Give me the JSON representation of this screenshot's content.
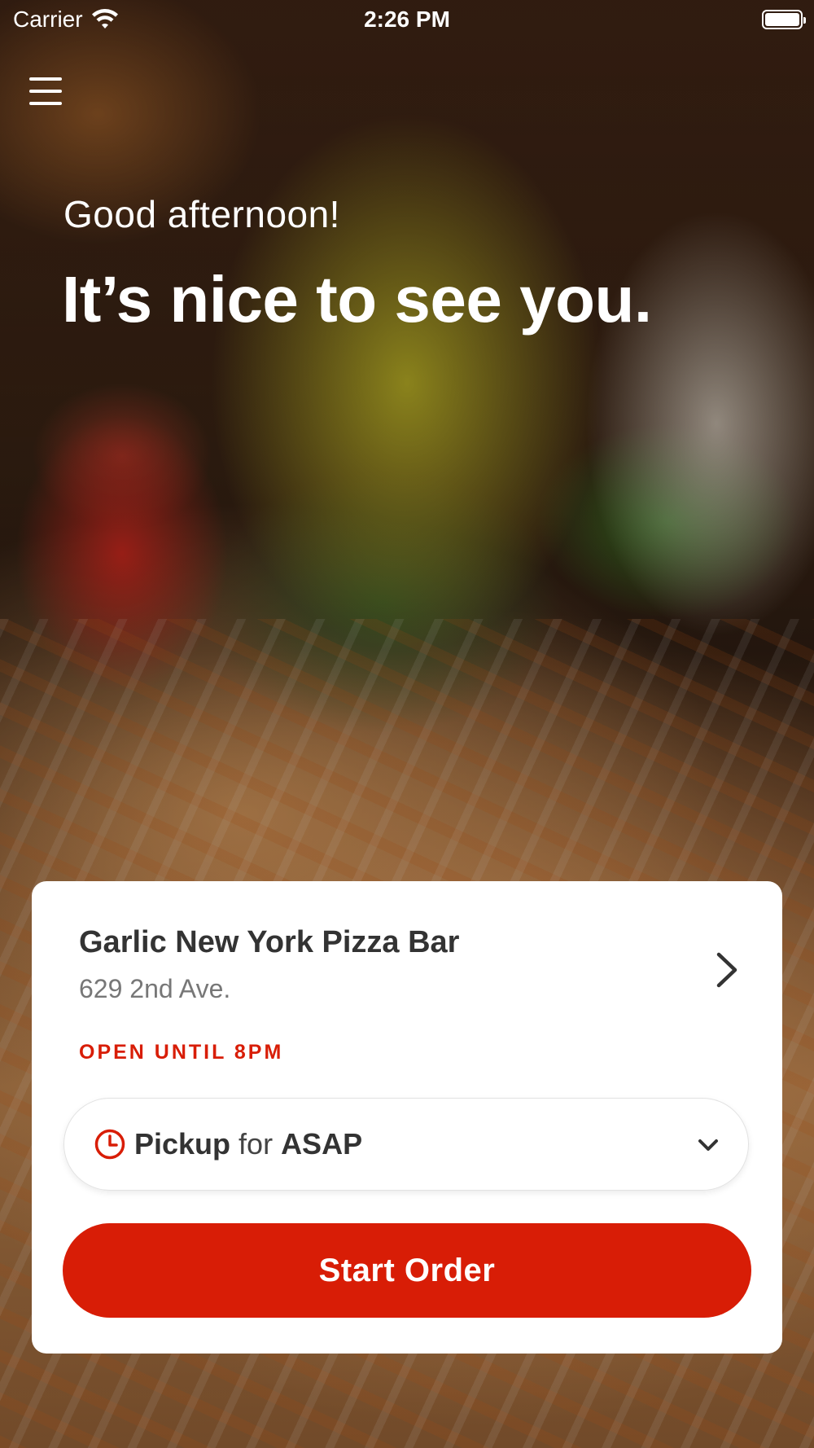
{
  "status_bar": {
    "carrier": "Carrier",
    "time": "2:26 PM",
    "icons": [
      "wifi-icon",
      "battery-icon"
    ]
  },
  "header": {
    "menu_icon": "hamburger-menu-icon"
  },
  "hero": {
    "greeting": "Good afternoon!",
    "headline": "It’s nice to see you."
  },
  "store": {
    "name": "Garlic New York Pizza Bar",
    "address": "629 2nd Ave.",
    "hours": "OPEN UNTIL 8PM",
    "chevron_icon": "chevron-right-icon"
  },
  "order_type": {
    "mode": "Pickup",
    "connector": "for",
    "time": "ASAP",
    "clock_icon": "clock-icon",
    "dropdown_icon": "chevron-down-icon"
  },
  "actions": {
    "start_order": "Start Order"
  },
  "colors": {
    "accent": "#d81d06",
    "card_bg": "#ffffff",
    "text_dark": "#333333",
    "text_muted": "#777777"
  }
}
